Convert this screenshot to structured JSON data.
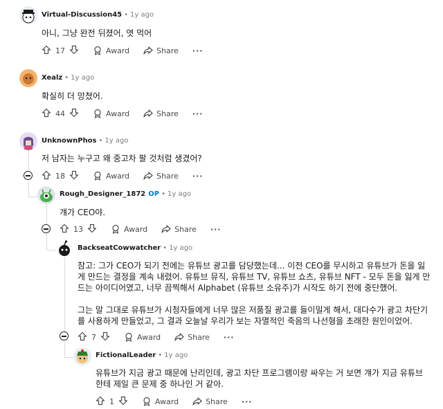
{
  "comments": [
    {
      "author": "Virtual-Discussion45",
      "time": "1y ago",
      "body": [
        "아니, 그냥 완전 뒤졌어, 엿 먹어"
      ],
      "votes": "17",
      "award": "Award",
      "share": "Share"
    },
    {
      "author": "Xealz",
      "time": "1y ago",
      "body": [
        "확실히 더 망쳤어."
      ],
      "votes": "44",
      "award": "Award",
      "share": "Share"
    },
    {
      "author": "UnknownPhos",
      "time": "1y ago",
      "body": [
        "저 남자는 누구고 왜 중고차 팔 것처럼 생겼어?"
      ],
      "votes": "18",
      "award": "Award",
      "share": "Share"
    },
    {
      "author": "Rough_Designer_1872",
      "op": "OP",
      "time": "1y ago",
      "body": [
        "걔가 CEO야."
      ],
      "votes": "13",
      "award": "Award",
      "share": "Share"
    },
    {
      "author": "BackseatCowwatcher",
      "time": "1y ago",
      "body": [
        "참고: 그가 CEO가 되기 전에는 유튜브 광고를 담당했는데... 이전 CEO를 무시하고 유튜브가 돈을 잃게 만드는 결정을 계속 내렸어. 유튜브 뮤직, 유튜브 TV, 유튜브 쇼츠, 유튜브 NFT - 모두 돈을 잃게 만드는 아이디어였고, 너무 끔찍해서 Alphabet (유튜브 소유주)가 시작도 하기 전에 중단했어.",
        "그는 말 그대로 유튜브가 시청자들에게 너무 많은 저품질 광고를 들이밀게 해서, 대다수가 광고 차단기를 사용하게 만들었고, 그 결과 오늘날 우리가 보는 자멸적인 죽음의 나선형을 초래한 원인이었어."
      ],
      "votes": "7",
      "award": "Award",
      "share": "Share"
    },
    {
      "author": "FictionalLeader",
      "time": "1y ago",
      "body": [
        "유튜브가 지금 광고 때문에 난리인데, 광고 차단 프로그램이랑 싸우는 거 보면 걔가 지금 유튜브한테 제일 큰 문제 중 하나인 거 같아."
      ],
      "votes": "1",
      "award": "Award",
      "share": "Share"
    }
  ],
  "more_label": "···"
}
